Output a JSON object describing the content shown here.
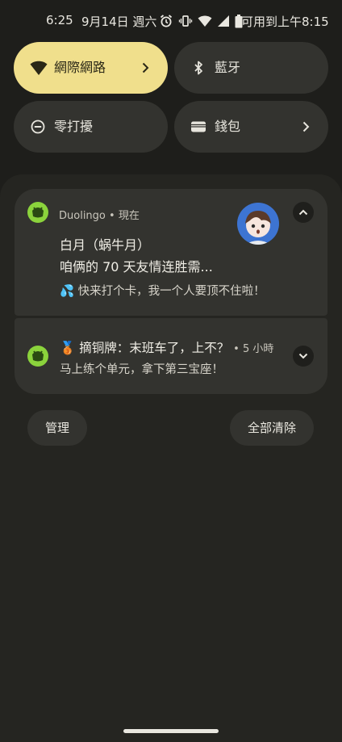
{
  "status_bar": {
    "time": "6:25",
    "date": "9月14日 週六",
    "battery_text": "可用到上午8:15",
    "icons": [
      "alarm-icon",
      "vibrate-icon",
      "wifi-icon",
      "cell-signal-icon",
      "battery-icon"
    ]
  },
  "quick_settings": {
    "tiles": [
      {
        "label": "網際網路",
        "icon": "wifi-icon",
        "active": true,
        "has_chevron": true
      },
      {
        "label": "藍牙",
        "icon": "bluetooth-icon",
        "active": false,
        "has_chevron": false
      },
      {
        "label": "零打擾",
        "icon": "do-not-disturb-icon",
        "active": false,
        "has_chevron": false
      },
      {
        "label": "錢包",
        "icon": "wallet-icon",
        "active": false,
        "has_chevron": true
      }
    ]
  },
  "notifications": [
    {
      "app": "Duolingo",
      "time": "• 現在",
      "title": "白月（蜗牛月）",
      "subtitle": "咱俩的 70 天友情连胜需...",
      "text": "💦 快来打个卡，我一个人要顶不住啦！",
      "expanded": true
    },
    {
      "title": "🥉 摘铜牌：末班车了，上不？",
      "time": "• 5 小時",
      "text": "马上练个单元，拿下第三宝座！",
      "expanded": false
    }
  ],
  "actions": {
    "manage": "管理",
    "clear_all": "全部清除"
  },
  "colors": {
    "background": "#1e1e1b",
    "tile_active": "#f0df8c",
    "tile_inactive": "#33332f",
    "duolingo_green": "#8bd33c",
    "avatar_blue": "#3d74d2"
  }
}
